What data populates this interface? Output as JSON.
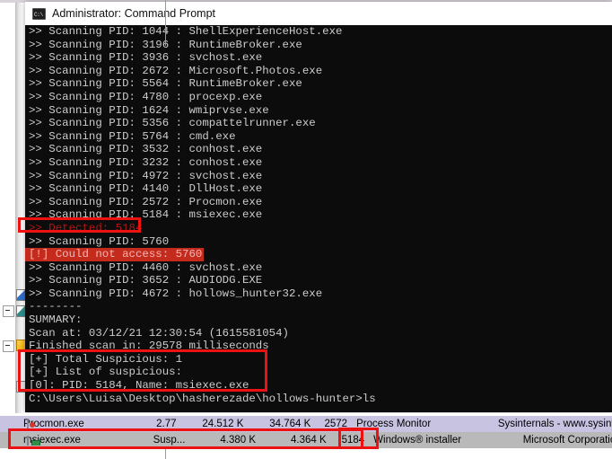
{
  "window": {
    "title": "Administrator: Command Prompt",
    "icon": "command-prompt-icon",
    "icon_glyph": "C:\\"
  },
  "console": {
    "lines": [
      {
        "text": ">> Scanning PID: 1044 : ShellExperienceHost.exe",
        "style": "normal"
      },
      {
        "text": ">> Scanning PID: 3196 : RuntimeBroker.exe",
        "style": "normal"
      },
      {
        "text": ">> Scanning PID: 3936 : svchost.exe",
        "style": "normal"
      },
      {
        "text": ">> Scanning PID: 2672 : Microsoft.Photos.exe",
        "style": "normal"
      },
      {
        "text": ">> Scanning PID: 5564 : RuntimeBroker.exe",
        "style": "normal"
      },
      {
        "text": ">> Scanning PID: 4780 : procexp.exe",
        "style": "normal"
      },
      {
        "text": ">> Scanning PID: 1624 : wmiprvse.exe",
        "style": "normal"
      },
      {
        "text": ">> Scanning PID: 5356 : compattelrunner.exe",
        "style": "normal"
      },
      {
        "text": ">> Scanning PID: 5764 : cmd.exe",
        "style": "normal"
      },
      {
        "text": ">> Scanning PID: 3532 : conhost.exe",
        "style": "normal"
      },
      {
        "text": ">> Scanning PID: 3232 : conhost.exe",
        "style": "normal"
      },
      {
        "text": ">> Scanning PID: 4972 : svchost.exe",
        "style": "normal"
      },
      {
        "text": ">> Scanning PID: 4140 : DllHost.exe",
        "style": "normal"
      },
      {
        "text": ">> Scanning PID: 2572 : Procmon.exe",
        "style": "normal"
      },
      {
        "text": ">> Scanning PID: 5184 : msiexec.exe",
        "style": "normal"
      },
      {
        "text": ">> Detected: 5184",
        "style": "red-on-black"
      },
      {
        "text": ">> Scanning PID: 5760",
        "style": "normal"
      },
      {
        "text": "[!] Could not access: 5760",
        "style": "red-bg"
      },
      {
        "text": ">> Scanning PID: 4460 : svchost.exe",
        "style": "normal"
      },
      {
        "text": ">> Scanning PID: 3652 : AUDIODG.EXE",
        "style": "normal"
      },
      {
        "text": ">> Scanning PID: 4672 : hollows_hunter32.exe",
        "style": "normal"
      },
      {
        "text": "--------",
        "style": "normal"
      },
      {
        "text": "SUMMARY:",
        "style": "normal"
      },
      {
        "text": "Scan at: 03/12/21 12:30:54 (1615581054)",
        "style": "normal"
      },
      {
        "text": "Finished scan in: 29578 milliseconds",
        "style": "normal"
      },
      {
        "text": "[+] Total Suspicious: 1",
        "style": "normal"
      },
      {
        "text": "[+] List of suspicious:",
        "style": "normal"
      },
      {
        "text": "[0]: PID: 5184, Name: msiexec.exe",
        "style": "normal"
      },
      {
        "text": "",
        "style": "normal"
      },
      {
        "text": "C:\\Users\\Luisa\\Desktop\\hasherezade\\hollows-hunter>ls",
        "style": "normal"
      }
    ]
  },
  "process_list": {
    "rows": [
      {
        "name": "Procmon.exe",
        "icon": "procmon-icon",
        "cpu": "2.77",
        "private_bytes": "24.512 K",
        "working_set": "34.764 K",
        "pid": "2572",
        "description": "Process Monitor",
        "company": "Sysinternals - www.sysinter...",
        "selected": false
      },
      {
        "name": "msiexec.exe",
        "icon": "msiexec-icon",
        "cpu": "Susp...",
        "private_bytes": "4.380 K",
        "working_set": "4.364 K",
        "pid": "5184",
        "description": "Windows® installer",
        "company": "Microsoft Corporation",
        "selected": true
      }
    ]
  },
  "annotations": {
    "color": "#ee1111",
    "boxes": [
      {
        "name": "detected-pid-highlight",
        "label": ">> Detected: 5184"
      },
      {
        "name": "suspicious-summary-highlight",
        "label": "[+] Total Suspicious / List of suspicious"
      },
      {
        "name": "msiexec-row-highlight",
        "label": "msiexec.exe row"
      },
      {
        "name": "msiexec-pid-highlight",
        "label": "5184"
      }
    ]
  }
}
